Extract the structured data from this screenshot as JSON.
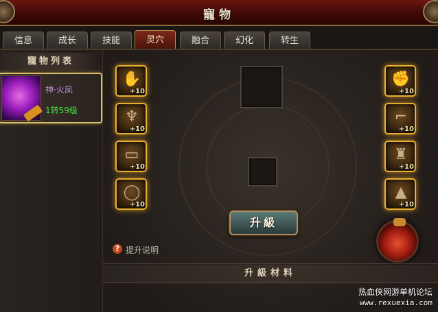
{
  "window": {
    "title": "寵物"
  },
  "tabs": [
    {
      "label": "信息"
    },
    {
      "label": "成长"
    },
    {
      "label": "技能"
    },
    {
      "label": "灵穴",
      "active": true
    },
    {
      "label": "融合"
    },
    {
      "label": "幻化"
    },
    {
      "label": "转生"
    }
  ],
  "pet_list": {
    "header": "寵物列表",
    "pets": [
      {
        "name": "神·火凤",
        "level": "1转59级",
        "selected": true
      }
    ]
  },
  "equipment_slots": {
    "left": [
      {
        "icon": "glove-icon",
        "bonus": "+10"
      },
      {
        "icon": "claw-icon",
        "bonus": "+10"
      },
      {
        "icon": "belt-icon",
        "bonus": "+10"
      },
      {
        "icon": "ring-icon",
        "bonus": "+10"
      }
    ],
    "right": [
      {
        "icon": "gauntlet-icon",
        "bonus": "+10"
      },
      {
        "icon": "boot-icon",
        "bonus": "+10"
      },
      {
        "icon": "greave-icon",
        "bonus": "+10"
      },
      {
        "icon": "cape-icon",
        "bonus": "+10"
      }
    ]
  },
  "upgrade_button": {
    "label": "升級"
  },
  "help": {
    "label": "提升说明"
  },
  "materials": {
    "header": "升級材料"
  },
  "watermark": {
    "line1": "热血侠网游单机论坛",
    "line2": "www.rexuexia.com"
  },
  "colors": {
    "accent_gold": "#e8b030",
    "title_red": "#6a1510",
    "level_green": "#48e040",
    "name_purple": "#c890e8"
  }
}
